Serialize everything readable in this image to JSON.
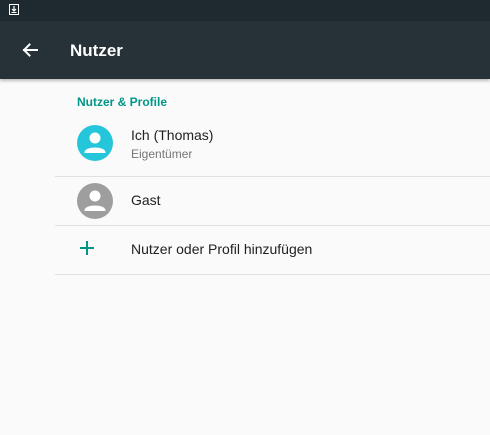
{
  "status_bar": {
    "icon": "download-icon"
  },
  "app_bar": {
    "back_icon": "arrow-back-icon",
    "title": "Nutzer"
  },
  "section": {
    "header": "Nutzer & Profile"
  },
  "users": [
    {
      "name": "Ich (Thomas)",
      "role": "Eigentümer",
      "avatar_icon": "person-icon",
      "avatar_color": "#26c6da"
    },
    {
      "name": "Gast",
      "avatar_icon": "person-icon",
      "avatar_color": "#9e9e9e"
    }
  ],
  "add_user": {
    "label": "Nutzer oder Profil hinzufügen",
    "icon": "add-icon",
    "icon_color": "#009688"
  },
  "colors": {
    "status_bar": "#1f2a30",
    "app_bar": "#263238",
    "accent": "#009688",
    "background": "#fafafa"
  }
}
